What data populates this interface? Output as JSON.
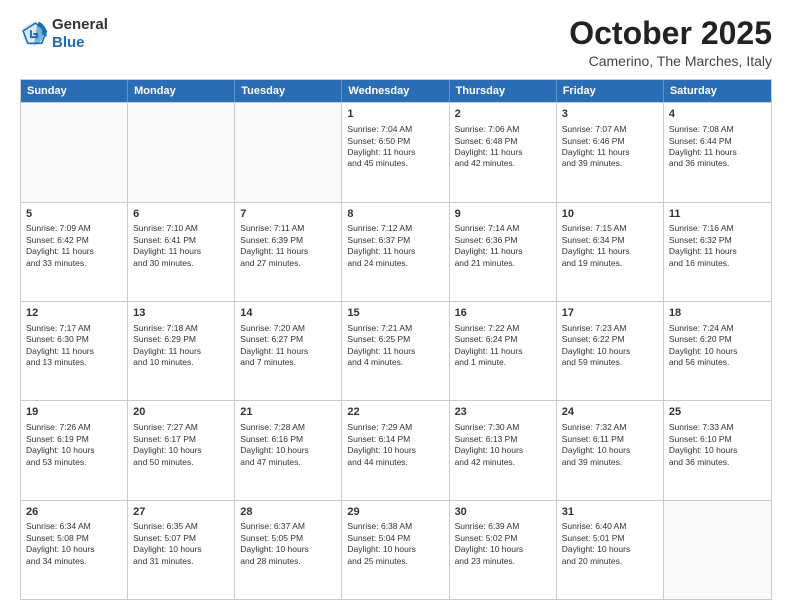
{
  "header": {
    "logo_general": "General",
    "logo_blue": "Blue",
    "month_title": "October 2025",
    "subtitle": "Camerino, The Marches, Italy"
  },
  "days_of_week": [
    "Sunday",
    "Monday",
    "Tuesday",
    "Wednesday",
    "Thursday",
    "Friday",
    "Saturday"
  ],
  "weeks": [
    [
      {
        "day": "",
        "info": ""
      },
      {
        "day": "",
        "info": ""
      },
      {
        "day": "",
        "info": ""
      },
      {
        "day": "1",
        "info": "Sunrise: 7:04 AM\nSunset: 6:50 PM\nDaylight: 11 hours\nand 45 minutes."
      },
      {
        "day": "2",
        "info": "Sunrise: 7:06 AM\nSunset: 6:48 PM\nDaylight: 11 hours\nand 42 minutes."
      },
      {
        "day": "3",
        "info": "Sunrise: 7:07 AM\nSunset: 6:46 PM\nDaylight: 11 hours\nand 39 minutes."
      },
      {
        "day": "4",
        "info": "Sunrise: 7:08 AM\nSunset: 6:44 PM\nDaylight: 11 hours\nand 36 minutes."
      }
    ],
    [
      {
        "day": "5",
        "info": "Sunrise: 7:09 AM\nSunset: 6:42 PM\nDaylight: 11 hours\nand 33 minutes."
      },
      {
        "day": "6",
        "info": "Sunrise: 7:10 AM\nSunset: 6:41 PM\nDaylight: 11 hours\nand 30 minutes."
      },
      {
        "day": "7",
        "info": "Sunrise: 7:11 AM\nSunset: 6:39 PM\nDaylight: 11 hours\nand 27 minutes."
      },
      {
        "day": "8",
        "info": "Sunrise: 7:12 AM\nSunset: 6:37 PM\nDaylight: 11 hours\nand 24 minutes."
      },
      {
        "day": "9",
        "info": "Sunrise: 7:14 AM\nSunset: 6:36 PM\nDaylight: 11 hours\nand 21 minutes."
      },
      {
        "day": "10",
        "info": "Sunrise: 7:15 AM\nSunset: 6:34 PM\nDaylight: 11 hours\nand 19 minutes."
      },
      {
        "day": "11",
        "info": "Sunrise: 7:16 AM\nSunset: 6:32 PM\nDaylight: 11 hours\nand 16 minutes."
      }
    ],
    [
      {
        "day": "12",
        "info": "Sunrise: 7:17 AM\nSunset: 6:30 PM\nDaylight: 11 hours\nand 13 minutes."
      },
      {
        "day": "13",
        "info": "Sunrise: 7:18 AM\nSunset: 6:29 PM\nDaylight: 11 hours\nand 10 minutes."
      },
      {
        "day": "14",
        "info": "Sunrise: 7:20 AM\nSunset: 6:27 PM\nDaylight: 11 hours\nand 7 minutes."
      },
      {
        "day": "15",
        "info": "Sunrise: 7:21 AM\nSunset: 6:25 PM\nDaylight: 11 hours\nand 4 minutes."
      },
      {
        "day": "16",
        "info": "Sunrise: 7:22 AM\nSunset: 6:24 PM\nDaylight: 11 hours\nand 1 minute."
      },
      {
        "day": "17",
        "info": "Sunrise: 7:23 AM\nSunset: 6:22 PM\nDaylight: 10 hours\nand 59 minutes."
      },
      {
        "day": "18",
        "info": "Sunrise: 7:24 AM\nSunset: 6:20 PM\nDaylight: 10 hours\nand 56 minutes."
      }
    ],
    [
      {
        "day": "19",
        "info": "Sunrise: 7:26 AM\nSunset: 6:19 PM\nDaylight: 10 hours\nand 53 minutes."
      },
      {
        "day": "20",
        "info": "Sunrise: 7:27 AM\nSunset: 6:17 PM\nDaylight: 10 hours\nand 50 minutes."
      },
      {
        "day": "21",
        "info": "Sunrise: 7:28 AM\nSunset: 6:16 PM\nDaylight: 10 hours\nand 47 minutes."
      },
      {
        "day": "22",
        "info": "Sunrise: 7:29 AM\nSunset: 6:14 PM\nDaylight: 10 hours\nand 44 minutes."
      },
      {
        "day": "23",
        "info": "Sunrise: 7:30 AM\nSunset: 6:13 PM\nDaylight: 10 hours\nand 42 minutes."
      },
      {
        "day": "24",
        "info": "Sunrise: 7:32 AM\nSunset: 6:11 PM\nDaylight: 10 hours\nand 39 minutes."
      },
      {
        "day": "25",
        "info": "Sunrise: 7:33 AM\nSunset: 6:10 PM\nDaylight: 10 hours\nand 36 minutes."
      }
    ],
    [
      {
        "day": "26",
        "info": "Sunrise: 6:34 AM\nSunset: 5:08 PM\nDaylight: 10 hours\nand 34 minutes."
      },
      {
        "day": "27",
        "info": "Sunrise: 6:35 AM\nSunset: 5:07 PM\nDaylight: 10 hours\nand 31 minutes."
      },
      {
        "day": "28",
        "info": "Sunrise: 6:37 AM\nSunset: 5:05 PM\nDaylight: 10 hours\nand 28 minutes."
      },
      {
        "day": "29",
        "info": "Sunrise: 6:38 AM\nSunset: 5:04 PM\nDaylight: 10 hours\nand 25 minutes."
      },
      {
        "day": "30",
        "info": "Sunrise: 6:39 AM\nSunset: 5:02 PM\nDaylight: 10 hours\nand 23 minutes."
      },
      {
        "day": "31",
        "info": "Sunrise: 6:40 AM\nSunset: 5:01 PM\nDaylight: 10 hours\nand 20 minutes."
      },
      {
        "day": "",
        "info": ""
      }
    ]
  ]
}
